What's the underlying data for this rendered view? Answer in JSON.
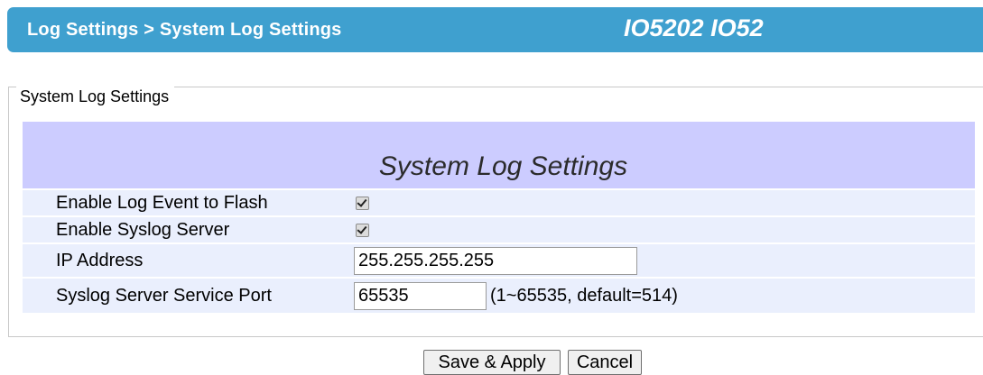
{
  "header": {
    "breadcrumb": "Log Settings > System Log Settings",
    "model": "IO5202 IO52"
  },
  "group": {
    "legend": "System Log Settings"
  },
  "table": {
    "title": "System Log Settings",
    "rows": {
      "log_flash": {
        "label": "Enable Log Event to Flash",
        "checked": true
      },
      "syslog_server": {
        "label": "Enable Syslog Server",
        "checked": true
      },
      "ip_address": {
        "label": "IP Address",
        "value": "255.255.255.255"
      },
      "service_port": {
        "label": "Syslog Server Service Port",
        "value": "65535",
        "hint": "(1~65535, default=514)"
      }
    }
  },
  "buttons": {
    "save_label": "Save & Apply",
    "cancel_label": "Cancel"
  },
  "colors": {
    "header_bg": "#3fa0cf",
    "table_title_bg": "#ccccff",
    "row_bg": "#eaeffd"
  },
  "icons": {
    "checkbox": "checkmark-icon"
  }
}
